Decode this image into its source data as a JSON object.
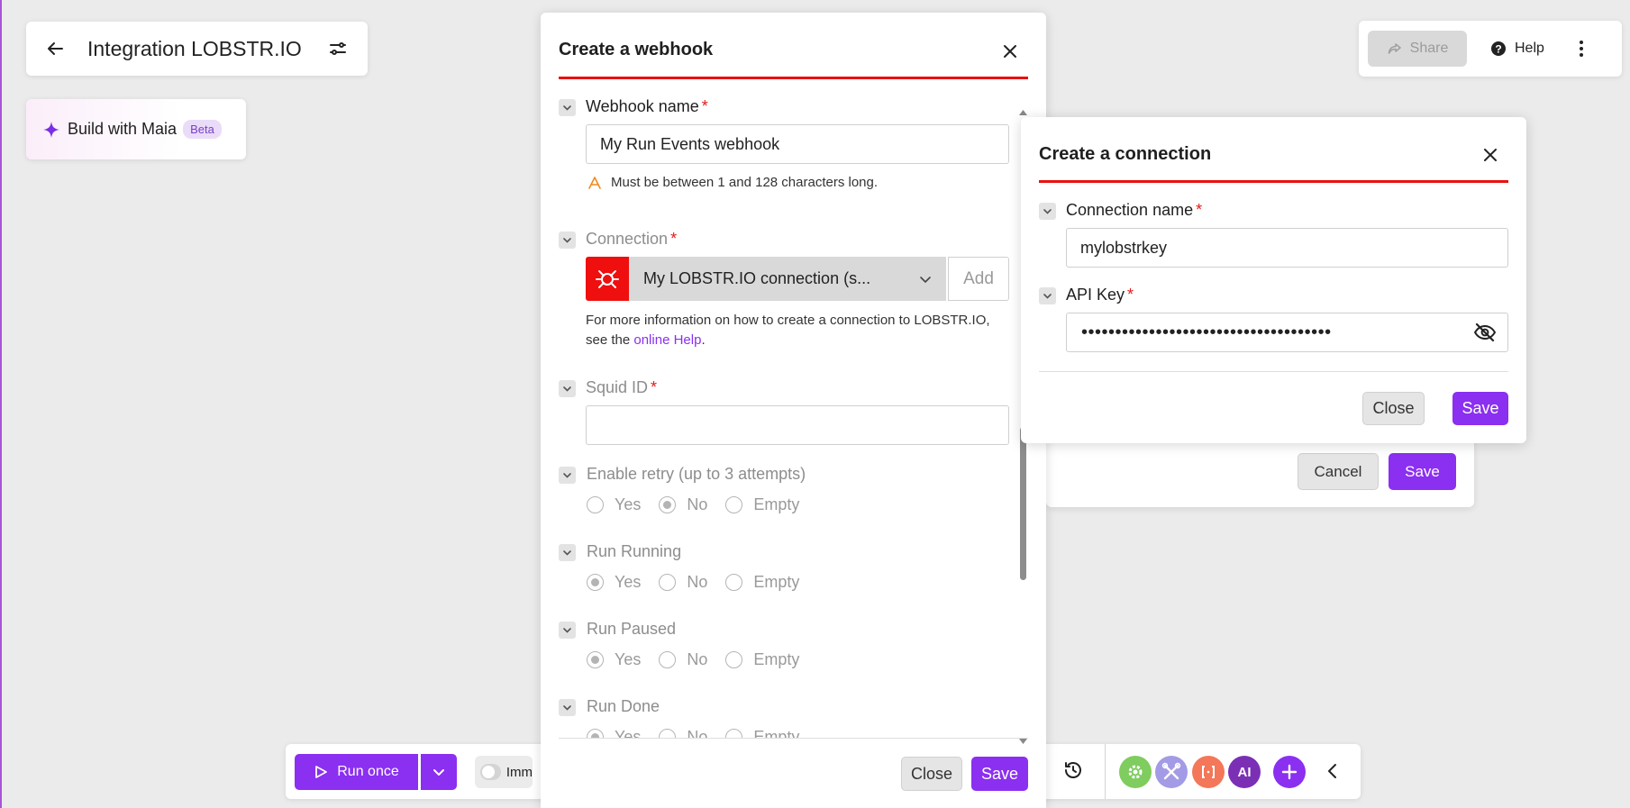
{
  "scenario": {
    "title": "Integration LOBSTR.IO"
  },
  "maia": {
    "label": "Build with Maia",
    "badge": "Beta"
  },
  "top_right": {
    "share_label": "Share",
    "help_label": "Help"
  },
  "bottom_bar": {
    "run_once_label": "Run once",
    "immediately_label": "Imm"
  },
  "webhook_modal": {
    "title": "Create a webhook",
    "webhook_name": {
      "label": "Webhook name",
      "required": "*",
      "value": "My Run Events webhook",
      "warning": "Must be between 1 and 128 characters long."
    },
    "connection": {
      "label": "Connection",
      "required": "*",
      "value": "My LOBSTR.IO connection (s...",
      "add_label": "Add",
      "help_prefix": "For more information on how to create a connection to LOBSTR.IO,",
      "help_see": "see the ",
      "help_link": "online Help",
      "help_suffix": "."
    },
    "squid_id": {
      "label": "Squid ID",
      "required": "*",
      "value": ""
    },
    "radio_groups": [
      {
        "label": "Enable retry (up to 3 attempts)",
        "options": [
          "Yes",
          "No",
          "Empty"
        ],
        "selected": "No"
      },
      {
        "label": "Run Running",
        "options": [
          "Yes",
          "No",
          "Empty"
        ],
        "selected": "Yes"
      },
      {
        "label": "Run Paused",
        "options": [
          "Yes",
          "No",
          "Empty"
        ],
        "selected": "Yes"
      },
      {
        "label": "Run Done",
        "options": [
          "Yes",
          "No",
          "Empty"
        ],
        "selected": "Yes"
      }
    ],
    "close_label": "Close",
    "save_label": "Save"
  },
  "behind_modal": {
    "cancel_label": "Cancel",
    "save_label": "Save"
  },
  "connection_modal": {
    "title": "Create a connection",
    "connection_name": {
      "label": "Connection name",
      "required": "*",
      "value": "mylobstrkey"
    },
    "api_key": {
      "label": "API Key",
      "required": "*",
      "masked_value": "•••••••••••••••••••••••••••••••••••••"
    },
    "close_label": "Close",
    "save_label": "Save"
  },
  "colors": {
    "accent": "#8b2ff0",
    "header_line": "#e8110f",
    "app_icon": "#ef0f0f"
  },
  "icons": {
    "back": "arrow-left-icon",
    "settings": "sliders-icon",
    "sparkle": "sparkle-icon",
    "share": "share-icon",
    "help": "question-circle-icon",
    "more": "more-vertical-icon",
    "close": "close-icon",
    "chevron": "chevron-down-icon",
    "warning": "warning-icon",
    "eye": "eye-off-icon",
    "history": "history-icon",
    "play": "play-icon"
  }
}
